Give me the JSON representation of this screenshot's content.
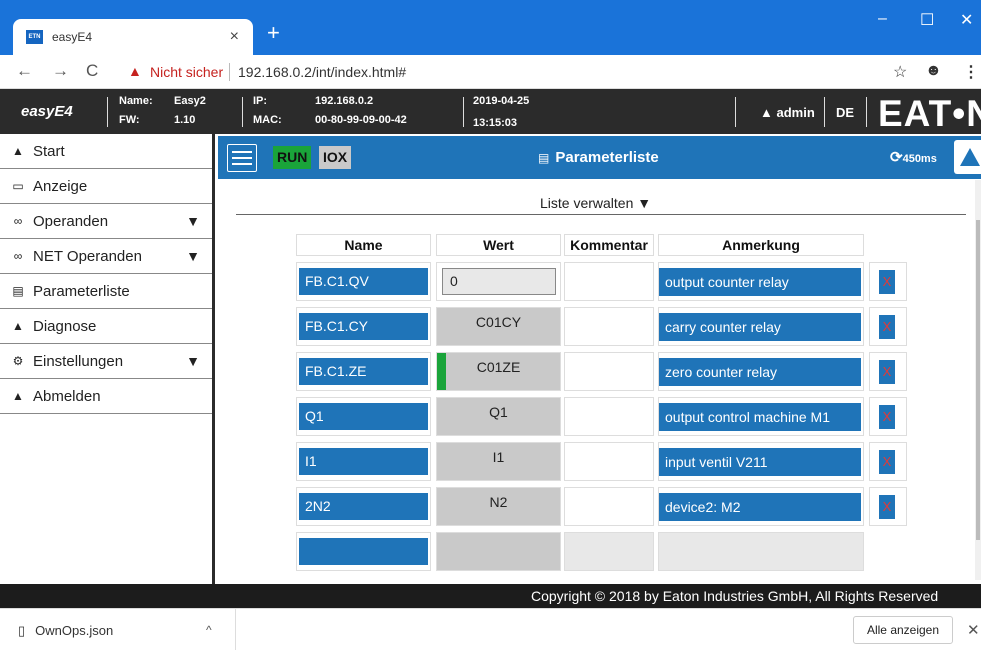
{
  "browser": {
    "tab_title": "easyE4",
    "favicon_text": "ETN",
    "tab_close": "×",
    "new_tab": "+",
    "minimize": "–",
    "maximize": "☐",
    "close": "✕",
    "back": "←",
    "forward": "→",
    "reload": "C",
    "security_warning": "Nicht sicher",
    "url": "192.168.0.2/int/index.html#",
    "bookmark_icon": "star-icon",
    "profile_icon": "account-icon",
    "menu_icon": "more-icon"
  },
  "device": {
    "logo": "easyE4",
    "name_label": "Name:",
    "name_value": "Easy2",
    "fw_label": "FW:",
    "fw_value": "1.10",
    "ip_label": "IP:",
    "ip_value": "192.168.0.2",
    "mac_label": "MAC:",
    "mac_value": "00-80-99-09-00-42",
    "date": "2019-04-25",
    "time": "13:15:03",
    "user": "admin",
    "language": "DE",
    "brand": "EAT•N"
  },
  "sidebar": {
    "items": [
      {
        "label": "Start",
        "icon": "home-icon",
        "expand": false
      },
      {
        "label": "Anzeige",
        "icon": "monitor-icon",
        "expand": false
      },
      {
        "label": "Operanden",
        "icon": "infinity-icon",
        "expand": true
      },
      {
        "label": "NET Operanden",
        "icon": "infinity-icon",
        "expand": true
      },
      {
        "label": "Parameterliste",
        "icon": "list-icon",
        "expand": false
      },
      {
        "label": "Diagnose",
        "icon": "warning-icon",
        "expand": false
      },
      {
        "label": "Einstellungen",
        "icon": "gear-icon",
        "expand": true
      },
      {
        "label": "Abmelden",
        "icon": "user-icon",
        "expand": false
      }
    ]
  },
  "toolbar": {
    "run": "RUN",
    "iox": "IOX",
    "title": "Parameterliste",
    "cycle_time": "450ms"
  },
  "main": {
    "manage_list": "Liste verwalten",
    "headers": [
      "Name",
      "Wert",
      "Kommentar",
      "Anmerkung"
    ],
    "rows": [
      {
        "name": "FB.C1.QV",
        "value": "0",
        "comment": "",
        "note": "output counter relay",
        "delete": "X",
        "editable": true,
        "indicator": false
      },
      {
        "name": "FB.C1.CY",
        "value": "C01CY",
        "comment": "",
        "note": "carry counter relay",
        "delete": "X",
        "editable": false,
        "indicator": false
      },
      {
        "name": "FB.C1.ZE",
        "value": "C01ZE",
        "comment": "",
        "note": "zero counter relay",
        "delete": "X",
        "editable": false,
        "indicator": true
      },
      {
        "name": "Q1",
        "value": "Q1",
        "comment": "",
        "note": "output control machine M1",
        "delete": "X",
        "editable": false,
        "indicator": false
      },
      {
        "name": "I1",
        "value": "I1",
        "comment": "",
        "note": "input ventil V211",
        "delete": "X",
        "editable": false,
        "indicator": false
      },
      {
        "name": "2N2",
        "value": "N2",
        "comment": "",
        "note": "device2: M2",
        "delete": "X",
        "editable": false,
        "indicator": false
      },
      {
        "name": "",
        "value": "",
        "comment": "",
        "note": "",
        "delete": "",
        "editable": false,
        "indicator": false
      }
    ]
  },
  "footer": {
    "copyright": "Copyright © 2018 by Eaton Industries GmbH, All Rights Reserved"
  },
  "downloads": {
    "file": "OwnOps.json",
    "show_all": "Alle anzeigen",
    "close": "✕"
  },
  "colors": {
    "accent": "#1f74b8",
    "run_green": "#1aa43a",
    "delete_red": "#e53935",
    "header_dark": "#2b2b2b",
    "browser_blue": "#1a73d9"
  }
}
